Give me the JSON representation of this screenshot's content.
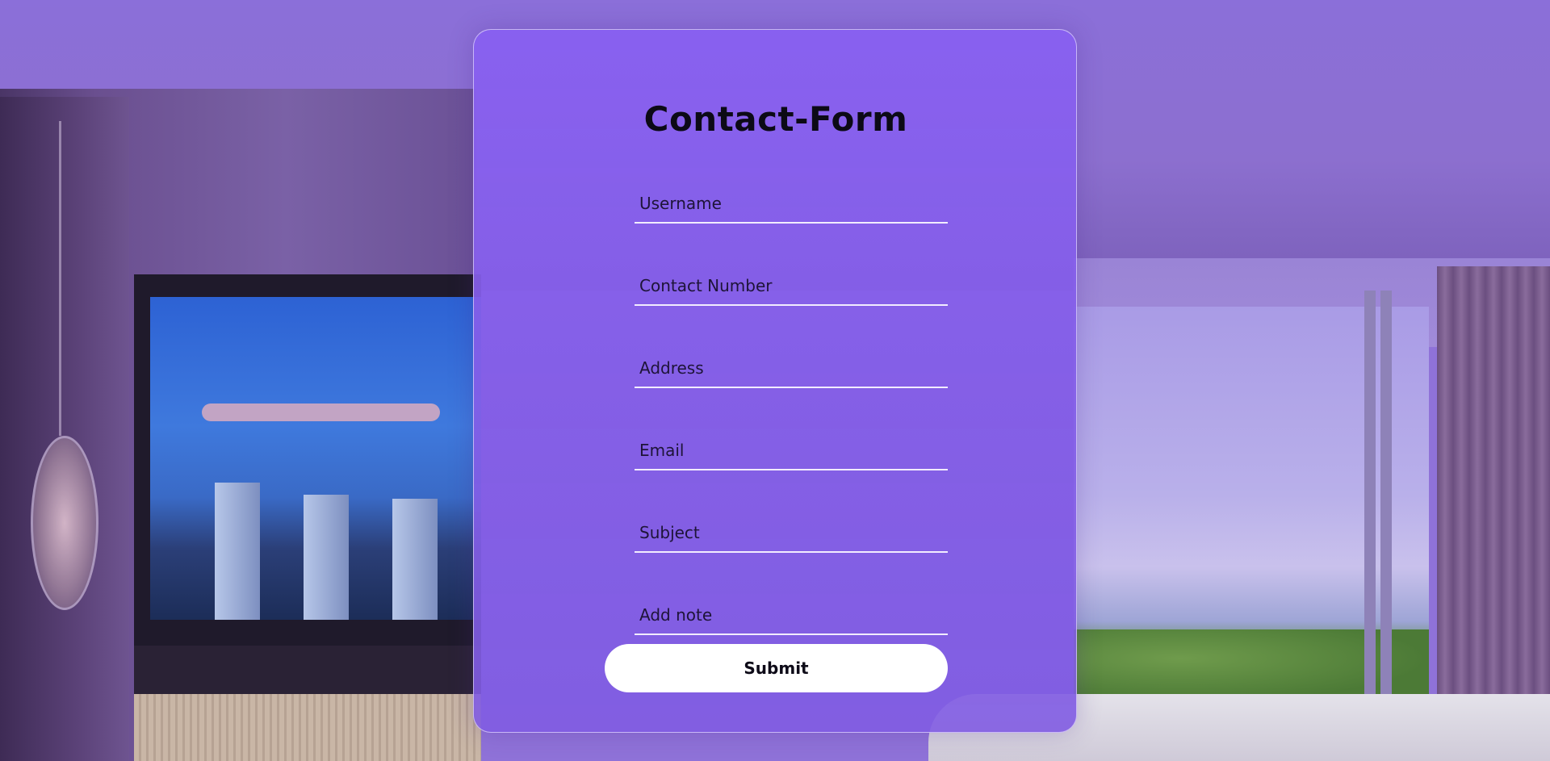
{
  "form": {
    "title": "Contact-Form",
    "fields": [
      {
        "name": "username",
        "placeholder": "Username",
        "value": ""
      },
      {
        "name": "contact_number",
        "placeholder": "Contact Number",
        "value": ""
      },
      {
        "name": "address",
        "placeholder": "Address",
        "value": ""
      },
      {
        "name": "email",
        "placeholder": "Email",
        "value": ""
      },
      {
        "name": "subject",
        "placeholder": "Subject",
        "value": ""
      },
      {
        "name": "note",
        "placeholder": "Add note",
        "value": ""
      }
    ],
    "submit_label": "Submit"
  },
  "colors": {
    "card_accent": "#8860f0",
    "title_text": "#0c0a16",
    "button_bg": "#ffffff"
  }
}
